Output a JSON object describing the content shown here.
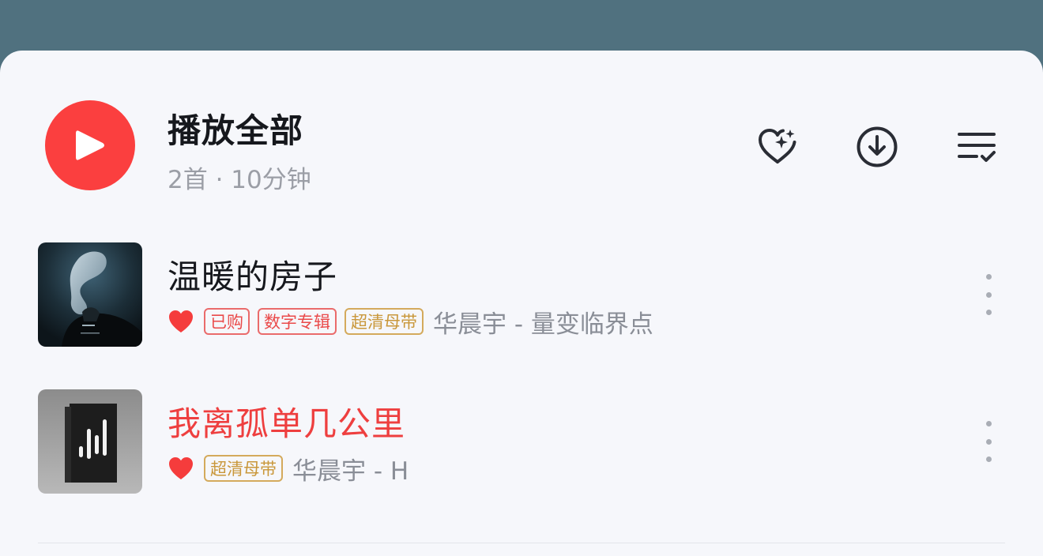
{
  "header": {
    "title": "播放全部",
    "subtitle": "2首 · 10分钟"
  },
  "colors": {
    "accent_red": "#fb3f3f",
    "playing_red": "#ee3f3f",
    "tag_red": "#ea4a4a",
    "tag_gold": "#c9973a",
    "backdrop": "#50717f"
  },
  "icons": {
    "play": "play-icon",
    "collect": "heart-sparkle-icon",
    "download": "download-icon",
    "multi_select": "list-check-icon",
    "liked": "heart-icon",
    "more": "more-vertical-icon"
  },
  "songs": [
    {
      "title": "温暖的房子",
      "liked": true,
      "tags": [
        "已购",
        "数字专辑",
        "超清母带"
      ],
      "artist_album": "华晨宇 - 量变临界点",
      "playing": false
    },
    {
      "title": "我离孤单几公里",
      "liked": true,
      "tags": [
        "超清母带"
      ],
      "artist_album": "华晨宇 - H",
      "playing": true
    }
  ]
}
